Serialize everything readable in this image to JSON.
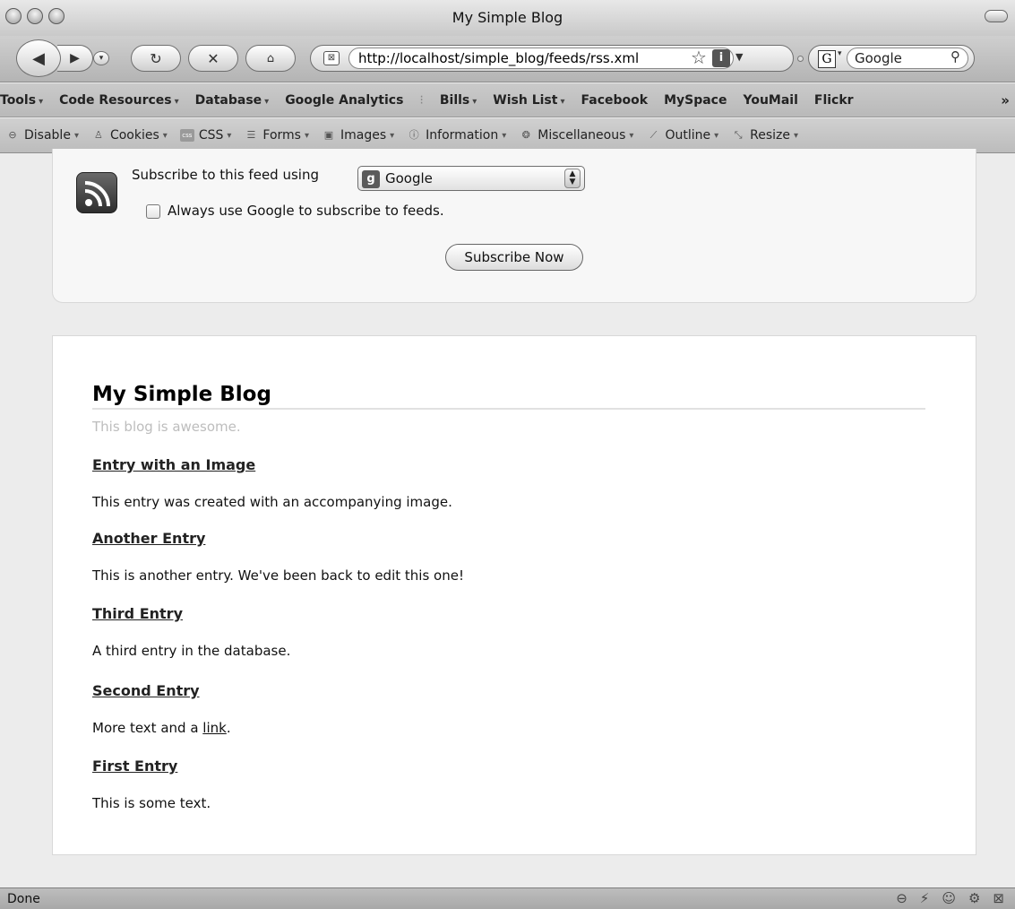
{
  "window": {
    "title": "My Simple Blog"
  },
  "nav": {
    "back_glyph": "◀",
    "forward_glyph": "▶",
    "history_glyph": "▾",
    "reload_glyph": "↻",
    "stop_glyph": "✕",
    "home_glyph": "⌂",
    "url": "http://localhost/simple_blog/feeds/rss.xml",
    "star_glyph": "☆",
    "info_glyph": "i",
    "url_dropdown_glyph": "▼",
    "search_engine_glyph": "G",
    "search_engine_caret": "▾",
    "search_placeholder": "Google",
    "search_glyph": "⚲"
  },
  "bookmarks": {
    "items": [
      "Tools",
      "Code Resources",
      "Database",
      "Google Analytics",
      "Bills",
      "Wish List",
      "Facebook",
      "MySpace",
      "YouMail",
      "Flickr"
    ],
    "more_glyph": "»",
    "dropdown_glyph": "▾"
  },
  "devtoolbar": {
    "items": [
      "Disable",
      "Cookies",
      "CSS",
      "Forms",
      "Images",
      "Information",
      "Miscellaneous",
      "Outline",
      "Resize"
    ],
    "dropdown_glyph": "▾"
  },
  "subscribe": {
    "prompt": "Subscribe to this feed using",
    "selected_reader": "Google",
    "reader_icon_glyph": "g",
    "always_label": "Always use Google to subscribe to feeds.",
    "button_label": "Subscribe Now"
  },
  "feed": {
    "title": "My Simple Blog",
    "subtitle": "This blog is awesome.",
    "entries": [
      {
        "title": "Entry with an Image",
        "body": "This entry was created with an accompanying image."
      },
      {
        "title": "Another Entry",
        "body": "This is another entry. We've been back to edit this one!"
      },
      {
        "title": "Third Entry",
        "body": "A third entry in the database."
      },
      {
        "title": "Second Entry",
        "body_before_link": "More text and a ",
        "link_text": "link",
        "body_after_link": "."
      },
      {
        "title": "First Entry",
        "body": "This is some text."
      }
    ]
  },
  "status": {
    "text": "Done"
  }
}
